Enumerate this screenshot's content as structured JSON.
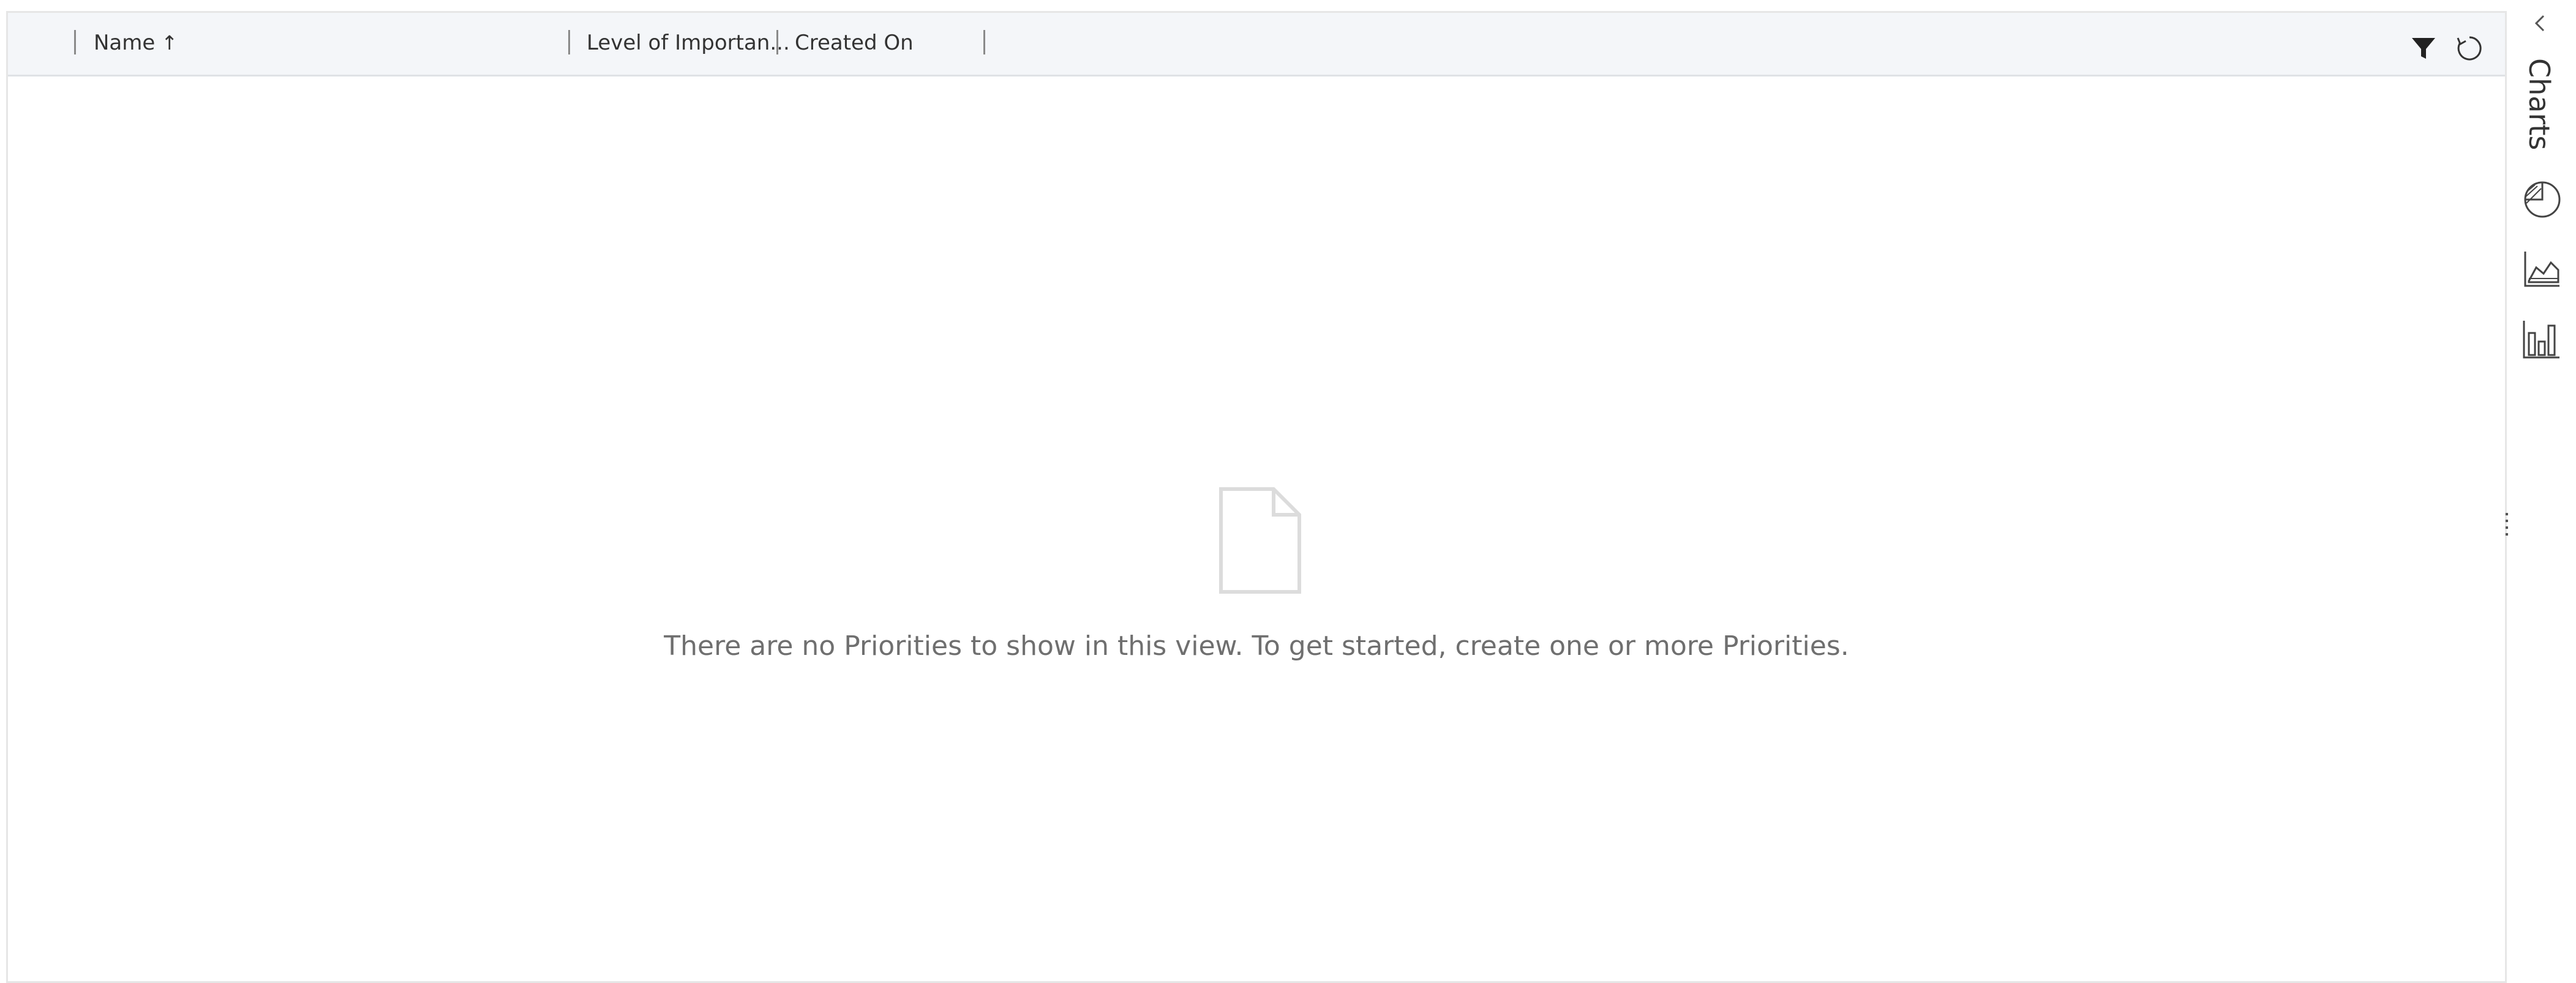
{
  "grid": {
    "columns": [
      {
        "label": "Name",
        "sort": "ascending"
      },
      {
        "label": "Level of Importan..."
      },
      {
        "label": "Created On"
      }
    ],
    "toolbar_icons": [
      "filter-icon",
      "refresh-icon"
    ]
  },
  "empty_state": {
    "icon": "document-icon",
    "message": "There are no Priorities to show in this view. To get started, create one or more Priorities."
  },
  "charts_pane": {
    "title": "Charts",
    "collapse_icon": "chevron-left-icon",
    "chart_types": [
      "pie-chart-icon",
      "area-chart-icon",
      "bar-chart-icon"
    ]
  },
  "colors": {
    "header_background": "#f4f6f9",
    "empty_text": "#6f6f6f",
    "border": "#e6e6e6"
  }
}
